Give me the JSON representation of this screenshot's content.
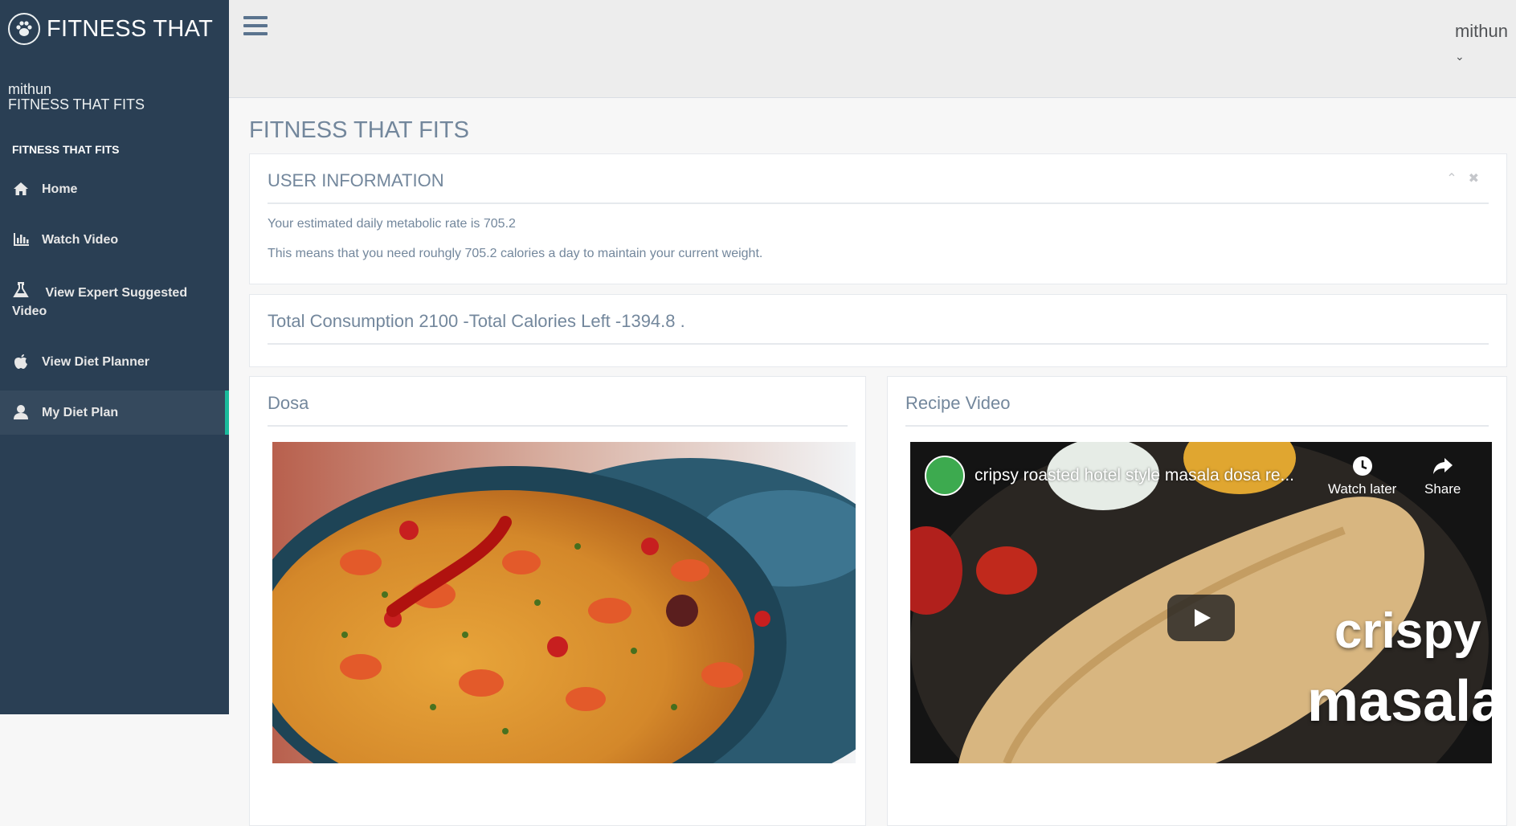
{
  "brand": {
    "name": "FITNESS THAT",
    "logo_icon": "paw-icon"
  },
  "profile": {
    "username": "mithun",
    "subtitle": "FITNESS THAT FITS"
  },
  "sidebar": {
    "section_title": "FITNESS THAT FITS",
    "items": [
      {
        "label": "Home",
        "icon": "home-icon"
      },
      {
        "label": "Watch Video",
        "icon": "bar-chart-icon"
      },
      {
        "label": "View Expert Suggested Video",
        "icon": "flask-icon"
      },
      {
        "label": "View Diet Planner",
        "icon": "apple-icon"
      },
      {
        "label": "My Diet Plan",
        "icon": "user-icon",
        "active": true
      }
    ]
  },
  "topbar": {
    "user": "mithun",
    "caret": "⌄"
  },
  "page": {
    "title": "FITNESS THAT FITS"
  },
  "user_info": {
    "title": "USER INFORMATION",
    "line1": "Your estimated daily metabolic rate is 705.2",
    "line2": "This means that you need rouhgly 705.2 calories a day to maintain your current weight.",
    "collapse_glyph": "⌃",
    "close_glyph": "✖"
  },
  "consumption": {
    "text": "Total Consumption 2100 -Total Calories Left -1394.8 ."
  },
  "food": {
    "title": "Dosa"
  },
  "recipe": {
    "title": "Recipe Video",
    "video_title": "cripsy roasted hotel style masala dosa re...",
    "watch_later": "Watch later",
    "share": "Share",
    "overlay_line1": "crispy",
    "overlay_line2": "masala"
  },
  "colors": {
    "sidebar": "#2a3f54",
    "accent": "#1abb9c",
    "text": "#73879c"
  }
}
